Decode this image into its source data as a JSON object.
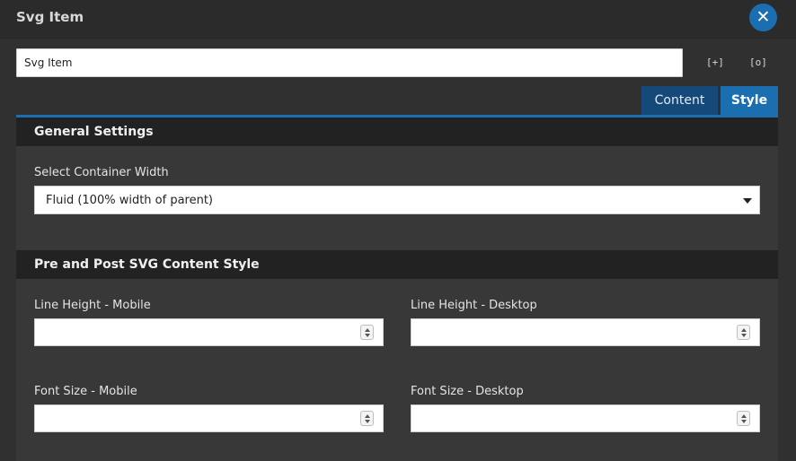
{
  "window": {
    "title": "Svg Item",
    "close_icon": "close-icon"
  },
  "name_field": {
    "value": "Svg Item"
  },
  "toolbar": {
    "expand_label": "[+]",
    "collapse_label": "[o]"
  },
  "tabs": [
    {
      "label": "Content",
      "active": false
    },
    {
      "label": "Style",
      "active": true
    }
  ],
  "general_settings": {
    "header": "General Settings",
    "container_width": {
      "label": "Select Container Width",
      "selected": "Fluid (100% width of parent)"
    }
  },
  "svg_content_style": {
    "header": "Pre and Post SVG Content Style",
    "line_height_mobile": {
      "label": "Line Height - Mobile",
      "value": ""
    },
    "line_height_desktop": {
      "label": "Line Height - Desktop",
      "value": ""
    },
    "font_size_mobile": {
      "label": "Font Size - Mobile",
      "value": ""
    },
    "font_size_desktop": {
      "label": "Font Size - Desktop",
      "value": ""
    }
  },
  "colors": {
    "accent": "#1b6fb0",
    "accent_dark": "#15497a",
    "background": "#303030"
  }
}
